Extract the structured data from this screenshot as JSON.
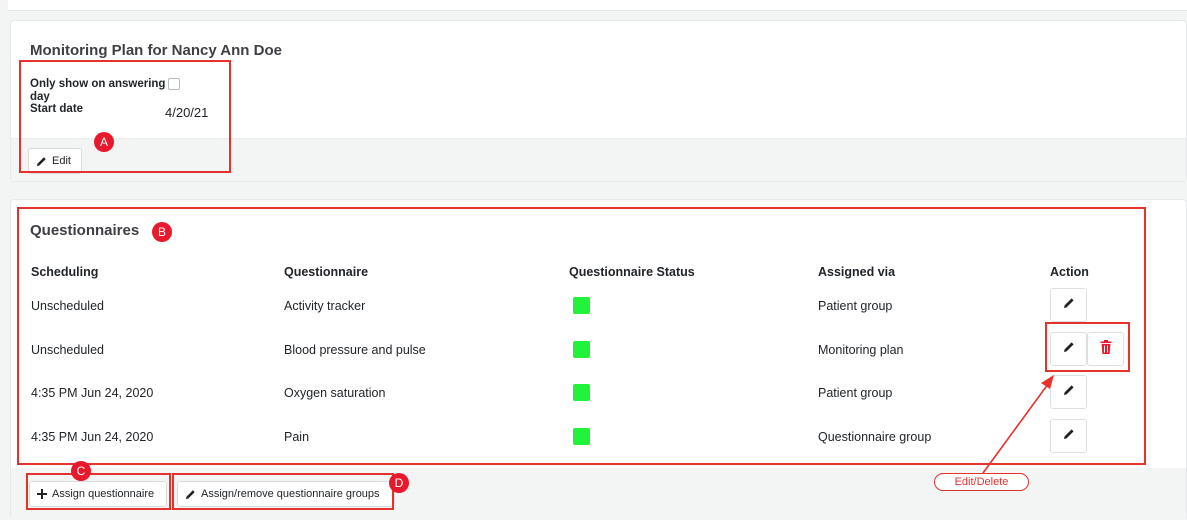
{
  "plan": {
    "title": "Monitoring Plan for Nancy Ann Doe",
    "only_show_label": "Only show on answering day",
    "only_show_checked": false,
    "start_date_label": "Start date",
    "start_date_value": "4/20/21",
    "edit_label": "Edit"
  },
  "questionnaires": {
    "title": "Questionnaires",
    "columns": [
      "Scheduling",
      "Questionnaire",
      "Questionnaire Status",
      "Assigned via",
      "Action"
    ],
    "rows": [
      {
        "scheduling": "Unscheduled",
        "questionnaire": "Activity tracker",
        "status_color": "#22f23a",
        "assigned_via": "Patient group",
        "actions": [
          "edit"
        ]
      },
      {
        "scheduling": "Unscheduled",
        "questionnaire": "Blood pressure and pulse",
        "status_color": "#22f23a",
        "assigned_via": "Monitoring plan",
        "actions": [
          "edit",
          "delete"
        ]
      },
      {
        "scheduling": "4:35 PM Jun 24, 2020",
        "questionnaire": "Oxygen saturation",
        "status_color": "#22f23a",
        "assigned_via": "Patient group",
        "actions": [
          "edit"
        ]
      },
      {
        "scheduling": "4:35 PM Jun 24, 2020",
        "questionnaire": "Pain",
        "status_color": "#22f23a",
        "assigned_via": "Questionnaire group",
        "actions": [
          "edit"
        ]
      }
    ],
    "assign_label": "Assign questionnaire",
    "assign_groups_label": "Assign/remove questionnaire groups"
  },
  "annotations": {
    "markers": [
      "A",
      "B",
      "C",
      "D"
    ],
    "callout": "Edit/Delete",
    "color": "#e5322d"
  },
  "icons": {
    "edit": "pencil-icon",
    "delete": "trash-icon",
    "add": "plus-icon"
  }
}
